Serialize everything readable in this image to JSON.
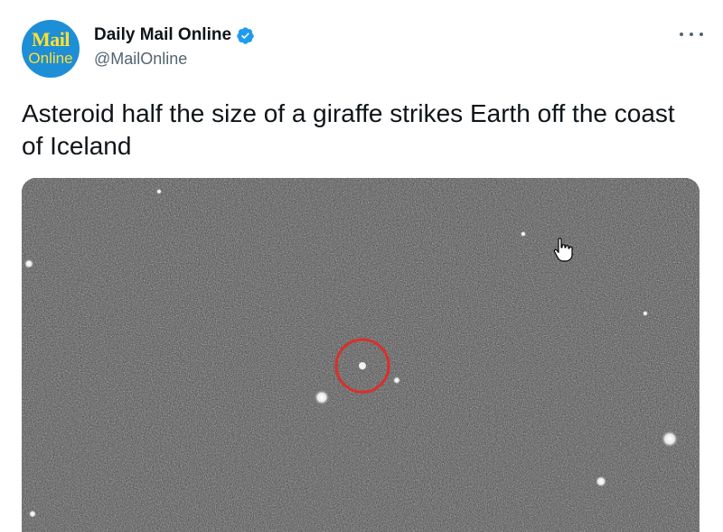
{
  "account": {
    "display_name": "Daily Mail Online",
    "handle": "@MailOnline",
    "verified": true,
    "verified_icon": "verified-badge-icon",
    "avatar": {
      "line1": "Mail",
      "line2": "Online",
      "background": "#1e8ed6",
      "text_color": "#ffe033"
    }
  },
  "more_icon": "more-options-icon",
  "tweet": {
    "text": "Asteroid half the size of a giraffe strikes Earth off the coast of Iceland"
  },
  "media": {
    "description_icon": "asteroid-photo",
    "highlight_color": "#d9302a",
    "cursor_icon": "hand-pointer-icon"
  },
  "colors": {
    "primary_text": "#0f1419",
    "secondary_text": "#536471",
    "verified_blue": "#1d9bf0"
  }
}
